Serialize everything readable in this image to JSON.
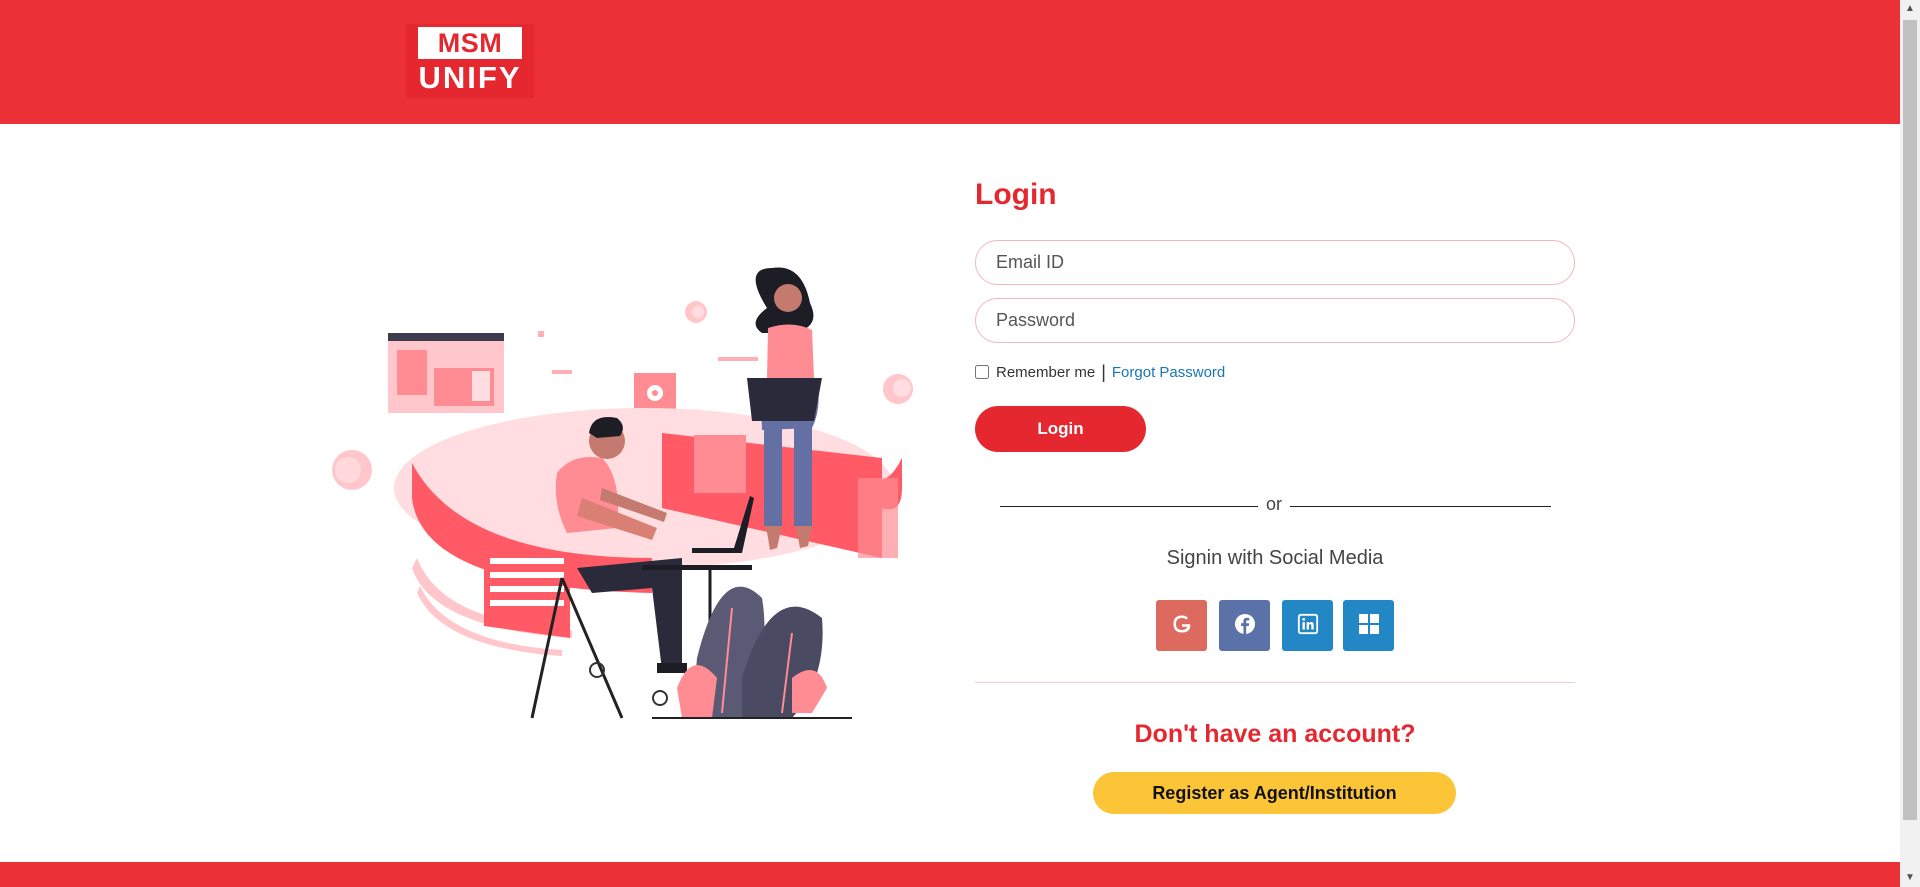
{
  "header": {
    "logo_top": "MSM",
    "logo_bottom": "UNIFY"
  },
  "login": {
    "title": "Login",
    "email_placeholder": "Email ID",
    "password_placeholder": "Password",
    "remember_label": "Remember me",
    "separator": "|",
    "forgot_label": "Forgot Password",
    "submit_label": "Login"
  },
  "divider": {
    "or_text": "or"
  },
  "social": {
    "title": "Signin with Social Media",
    "buttons": [
      {
        "icon": "google-icon",
        "color": "#dd6a5f"
      },
      {
        "icon": "facebook-icon",
        "color": "#5b72a8"
      },
      {
        "icon": "linkedin-icon",
        "color": "#2386c5"
      },
      {
        "icon": "windows-icon",
        "color": "#2386c5"
      }
    ]
  },
  "register": {
    "question": "Don't have an account?",
    "button_label": "Register as Agent/Institution"
  },
  "colors": {
    "brand_red": "#ec3038",
    "accent_yellow": "#fbc537",
    "link_blue": "#1876b6"
  }
}
